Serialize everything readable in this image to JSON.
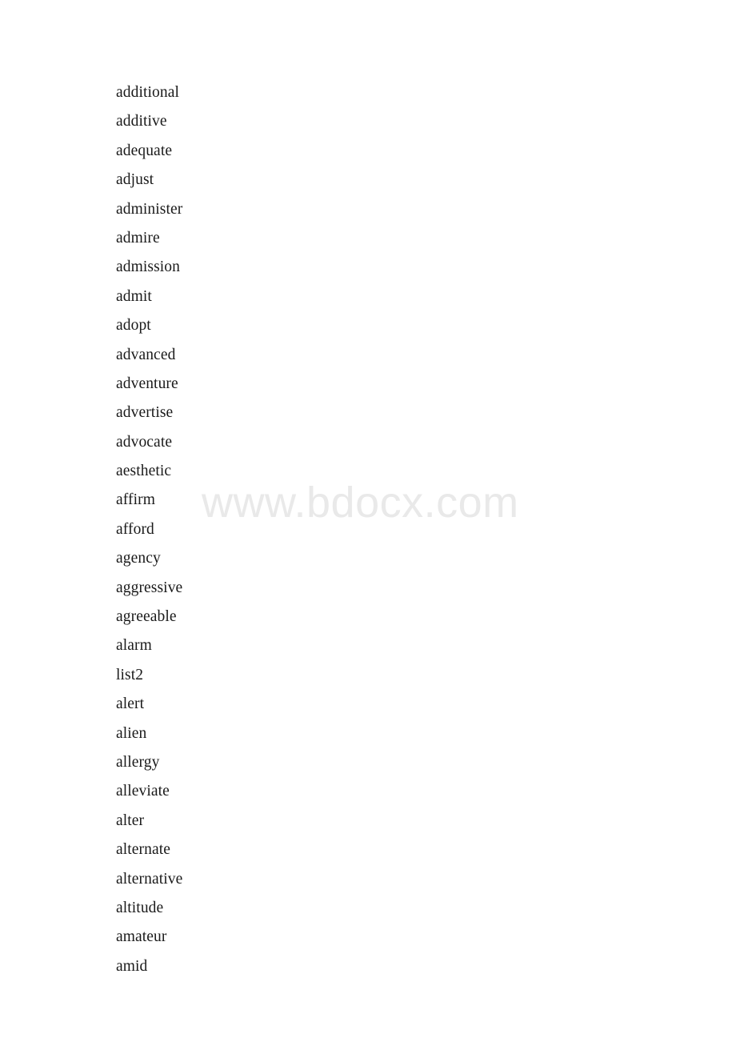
{
  "document": {
    "background_color": "#ffffff",
    "text_color": "#1a1a1a"
  },
  "watermark": {
    "text": "www.bdocx.com",
    "color": "#e9e9e9"
  },
  "word_list": {
    "items": [
      "additional",
      "additive",
      "adequate",
      "adjust",
      "administer",
      "admire",
      "admission",
      "admit",
      "adopt",
      "advanced",
      "adventure",
      "advertise",
      "advocate",
      "aesthetic",
      "affirm",
      "afford",
      "agency",
      "aggressive",
      "agreeable",
      "alarm",
      "list2",
      "alert",
      "alien",
      "allergy",
      "alleviate",
      "alter",
      "alternate",
      "alternative",
      "altitude",
      "amateur",
      "amid"
    ]
  }
}
